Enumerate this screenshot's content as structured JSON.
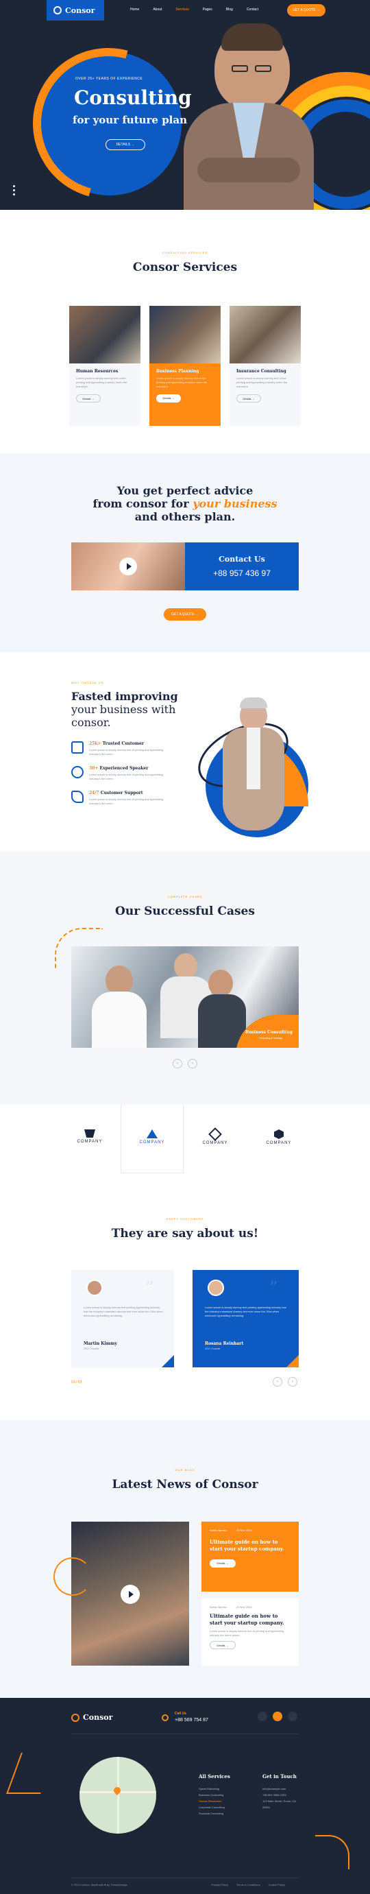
{
  "header": {
    "logo": "Consor",
    "nav": [
      "Home",
      "About",
      "Services",
      "Pages",
      "Blog",
      "Contact"
    ],
    "active_nav": "Services",
    "cta": "GET A QUOTE →"
  },
  "hero": {
    "eyebrow": "OVER 25+ YEARS OF EXPERIENCE",
    "title": "Consulting",
    "subtitle": "for your future plan",
    "button": "DETAILS →"
  },
  "services": {
    "eyebrow": "CONSULTING SERVICES",
    "title": "Consor Services",
    "cards": [
      {
        "title": "Human Resources",
        "text": "Lorem ipsum is simply dummy text of the printing and typesetting industry lorem the industry's.",
        "button": "Details →"
      },
      {
        "title": "Business Planning",
        "text": "Lorem ipsum is simply dummy text of the printing and typesetting industry lorem the industry's.",
        "button": "Details →"
      },
      {
        "title": "Insurance Consulting",
        "text": "Lorem ipsum is simply dummy text of the printing and typesetting industry lorem the industry's.",
        "button": "Details →"
      }
    ]
  },
  "advice": {
    "line1": "You get perfect advice",
    "line2a": "from consor for ",
    "line2b": "your business",
    "line3": "and others plan.",
    "contact_label": "Contact Us",
    "phone": "+88 957 436 97",
    "button": "GET A QUOTE →"
  },
  "improve": {
    "eyebrow": "WHY CHOOSE US",
    "line1": "Fasted improving",
    "line2": "your business with",
    "line3": "consor.",
    "features": [
      {
        "num": "25k+",
        "title": "Trusted Customer",
        "text": "Lorem ipsum is simply dummy text of printing and typesetting industry's the lorem."
      },
      {
        "num": "30+",
        "title": "Experienced Speaker",
        "text": "Lorem ipsum is simply dummy text of printing and typesetting industry's the lorem."
      },
      {
        "num": "24/7",
        "title": "Customer Support",
        "text": "Lorem ipsum is simply dummy text of printing and typesetting industry's the lorem."
      }
    ]
  },
  "cases": {
    "eyebrow": "COMPLETE CASES",
    "title": "Our Successful Cases",
    "card_title": "Business Consulting",
    "card_sub": "Consulting & Strategy"
  },
  "logos": [
    "COMPANY",
    "COMPANY",
    "COMPANY",
    "COMPANY"
  ],
  "testimonials": {
    "eyebrow": "HAPPY CUSTOMERS",
    "title": "They are say about us!",
    "items": [
      {
        "text": "Lorem ipsum is simply dummy text printing typesetting industry has the industry's standard dummy text ever since the 15cs when electronic typesetting remaining.",
        "name": "Martin Kimmy",
        "role": "CEO, Founder"
      },
      {
        "text": "Lorem ipsum is simply dummy text printing typesetting industry has the industry's standard dummy text ever since the 15cs when electronic typesetting remaining.",
        "name": "Rosana Reinhart",
        "role": "CEO, Founder"
      }
    ],
    "counter": "01 / 03"
  },
  "news": {
    "eyebrow": "OUR BLOG",
    "title": "Latest News of Consor",
    "posts": [
      {
        "author": "Admin Bpress",
        "date": "23 Nov 2024",
        "title": "Ultimate guide on how to start your startup company.",
        "text": "Lorem ipsum is simply dummy text of printing and typesetting industry the lorem ipsum.",
        "button": "Details →"
      },
      {
        "author": "Admin Bpress",
        "date": "23 Nov 2024",
        "title": "Ultimate guide on how to start your startup company.",
        "text": "Lorem ipsum is simply dummy text of printing and typesetting industry the lorem ipsum.",
        "button": "Details →"
      }
    ]
  },
  "footer": {
    "logo": "Consor",
    "call_label": "Call Us",
    "phone": "+88 569 754 87",
    "services_title": "All Services",
    "services": [
      "Speed Marketing",
      "Business Consulting",
      "Human Resources",
      "Corporate Consulting",
      "Financial Consulting"
    ],
    "touch_title": "Get in Touch",
    "touch": [
      "info@example.com",
      "+88 954 3658 1254",
      "123 Main Street, Rome, CA 90001"
    ],
    "copyright": "© 2024 Consor. Made with ♥ by ThemeDesign",
    "links": [
      "Privacy Policy",
      "Terms & Conditions",
      "Cookie Policy"
    ]
  }
}
